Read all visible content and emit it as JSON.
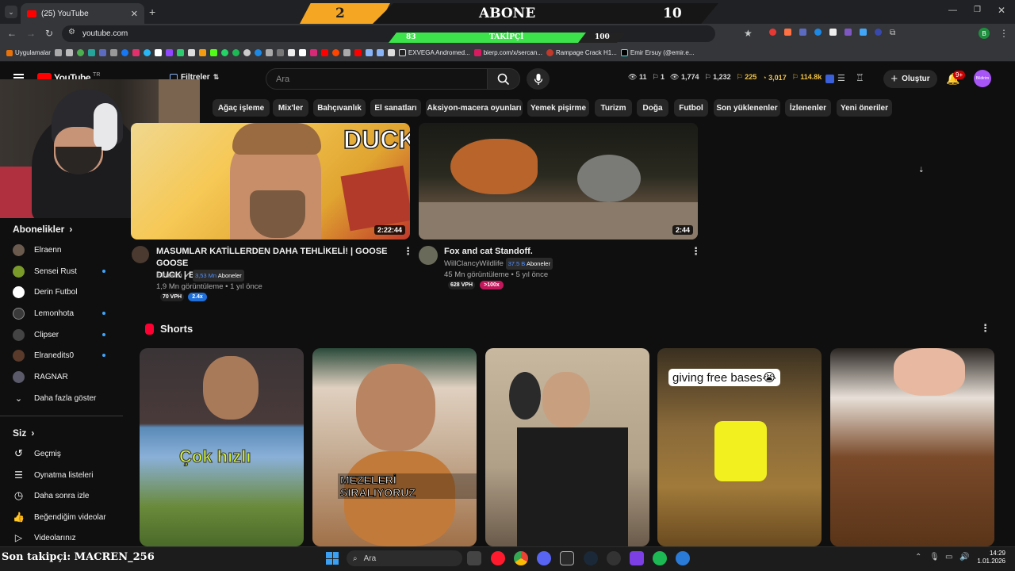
{
  "browser": {
    "tab_title": "(25) YouTube",
    "url": "youtube.com",
    "bookmarks": [
      "Uygulamalar",
      "EXVEGA Andromed...",
      "bierp.com/x/sercan...",
      "Rampage Crack H1...",
      "Emir Ersuy (@emir.e..."
    ]
  },
  "overlay": {
    "count_left": "2",
    "label": "ABONE",
    "count_right": "10",
    "progress_start": "83",
    "progress_label": "TAKİPÇİ",
    "progress_end": "100",
    "progress_fraction": 0.83,
    "last_follower": "Son takipçi: MACREN_256"
  },
  "header": {
    "logo": "YouTube",
    "region": "TR",
    "filters_label": "Filtreler",
    "search_placeholder": "Ara",
    "stats": [
      "11",
      "1",
      "1,774",
      "1,232",
      "225",
      "3,017",
      "114.8k"
    ],
    "create_label": "Oluştur",
    "notif_count": "9+",
    "avatar_label": "Bildirim"
  },
  "chips": [
    "Ağaç işleme",
    "Mix'ler",
    "Bahçıvanlık",
    "El sanatları",
    "Aksiyon-macera oyunları",
    "Yemek pişirme",
    "Turizm",
    "Doğa",
    "Futbol",
    "Son yüklenenler",
    "İzlenenler",
    "Yeni öneriler"
  ],
  "sidebar": {
    "subs_title": "Abonelikler",
    "subs": [
      {
        "name": "Elraenn",
        "color": "#6b5b4f"
      },
      {
        "name": "Sensei Rust",
        "color": "#7a9a2a"
      },
      {
        "name": "Derin Futbol",
        "color": "#ffffff"
      },
      {
        "name": "Lemonhota",
        "color": "#3a3a3a"
      },
      {
        "name": "Clipser",
        "color": "#444"
      },
      {
        "name": "Elranedits0",
        "color": "#5a3a2a"
      },
      {
        "name": "RAGNAR",
        "color": "#5a5a6a"
      }
    ],
    "show_more": "Daha fazla göster",
    "you_title": "Siz",
    "you_items": [
      "Geçmiş",
      "Oynatma listeleri",
      "Daha sonra izle",
      "Beğendiğim videolar",
      "Videolarınız"
    ]
  },
  "videos": [
    {
      "title_line1": "MASUMLAR KATİLLERDEN DAHA TEHLİKELİ! | GOOSE GOOSE",
      "title_line2": "DUCK | BÖLÜM 9 |",
      "channel": "Elraenn",
      "subs": "3,53 Mn",
      "subs_suffix": "Aboneler",
      "meta": "1,9 Mn görüntüleme • 1 yıl önce",
      "vph": "70 VPH",
      "mult": "2.4x",
      "duration": "2:22:44",
      "thumb_text": "DUCK"
    },
    {
      "title_line1": "Fox and cat Standoff.",
      "channel": "WillClancyWildlife",
      "subs": "37.5 B",
      "subs_suffix": "Aboneler",
      "meta": "45 Mn görüntüleme • 5 yıl önce",
      "vph": "628 VPH",
      "mult": ">100x",
      "duration": "2:44"
    }
  ],
  "shorts": {
    "title": "Shorts",
    "items": [
      {
        "overlay": "Çok hızlı"
      },
      {
        "overlay": "MEZELERİ SIRALIYORUZ"
      },
      {
        "overlay": ""
      },
      {
        "overlay": "giving free bases😭"
      },
      {
        "overlay": ""
      }
    ]
  },
  "taskbar": {
    "search": "Ara",
    "time": "14:29",
    "date": "1.01.2026"
  }
}
